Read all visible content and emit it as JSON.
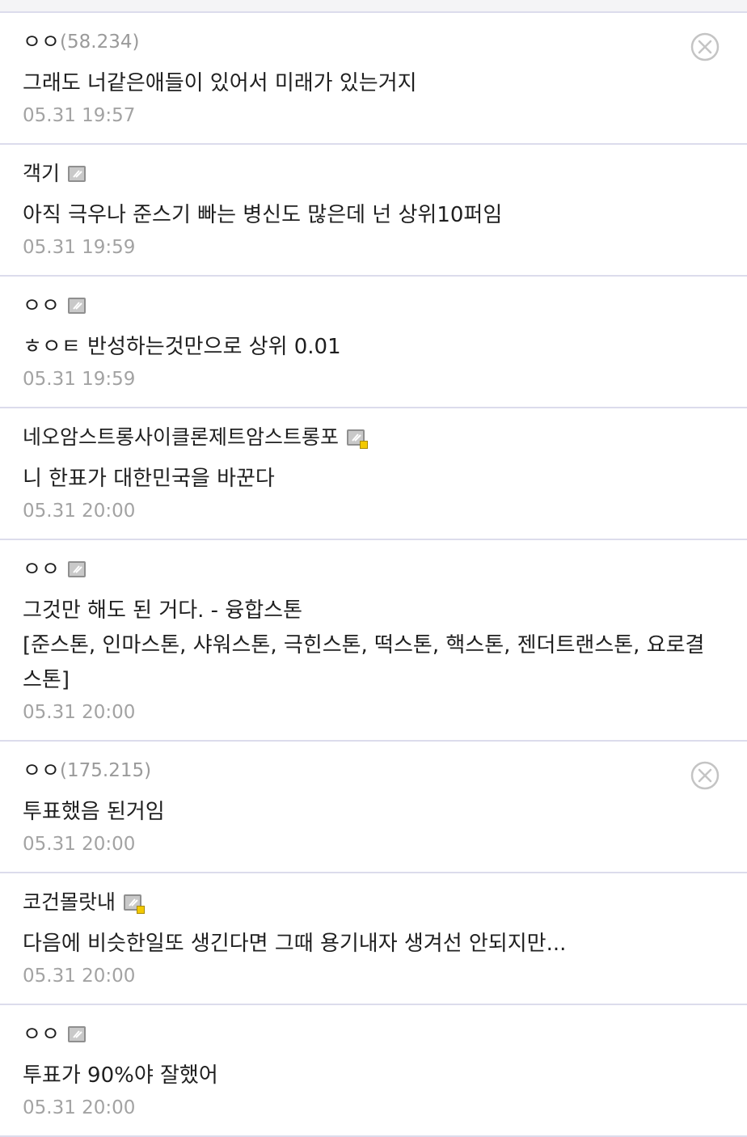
{
  "comments": [
    {
      "author": "ㅇㅇ",
      "ip": "(58.234)",
      "badge": "none",
      "has_delete": true,
      "lines": [
        "그래도 너같은애들이 있어서 미래가 있는거지"
      ],
      "date": "05.31 19:57"
    },
    {
      "author": "객기",
      "ip": "",
      "badge": "fixed-nick",
      "has_delete": false,
      "lines": [
        "아직 극우나 준스기 빠는 병신도 많은데 넌 상위10퍼임"
      ],
      "date": "05.31 19:59"
    },
    {
      "author": "ㅇㅇ",
      "ip": "",
      "badge": "fixed-nick",
      "has_delete": false,
      "lines": [
        "ㅎㅇㅌ 반성하는것만으로 상위 0.01"
      ],
      "date": "05.31 19:59"
    },
    {
      "author": "네오암스트롱사이클론제트암스트롱포",
      "ip": "",
      "badge": "half-fixed-nick",
      "has_delete": false,
      "lines": [
        "니 한표가 대한민국을 바꾼다"
      ],
      "date": "05.31 20:00"
    },
    {
      "author": "ㅇㅇ",
      "ip": "",
      "badge": "fixed-nick",
      "has_delete": false,
      "lines": [
        "그것만 해도 된 거다. - 융합스톤",
        "[준스톤, 인마스톤, 샤워스톤, 극힌스톤, 떡스톤, 핵스톤, 젠더트랜스톤, 요로결",
        "스톤]"
      ],
      "date": "05.31 20:00"
    },
    {
      "author": "ㅇㅇ",
      "ip": "(175.215)",
      "badge": "none",
      "has_delete": true,
      "lines": [
        "투표했음 된거임"
      ],
      "date": "05.31 20:00"
    },
    {
      "author": "코건몰랏내",
      "ip": "",
      "badge": "half-fixed-nick",
      "has_delete": false,
      "lines": [
        "다음에 비슷한일또 생긴다면 그때 용기내자 생겨선 안되지만..."
      ],
      "date": "05.31 20:00"
    },
    {
      "author": "ㅇㅇ",
      "ip": "",
      "badge": "fixed-nick",
      "has_delete": false,
      "lines": [
        "투표가 90%야 잘했어"
      ],
      "date": "05.31 20:00"
    }
  ],
  "icons": {
    "delete": "close-circle-icon",
    "fixed_nick_badge": "gallery-nick-badge-icon",
    "half_fixed_nick_badge": "half-nick-badge-icon"
  },
  "colors": {
    "divider": "#dcdcec",
    "date": "#a3a3a3",
    "ip": "#9a9a9a",
    "badge_dot": "#f3c900"
  }
}
